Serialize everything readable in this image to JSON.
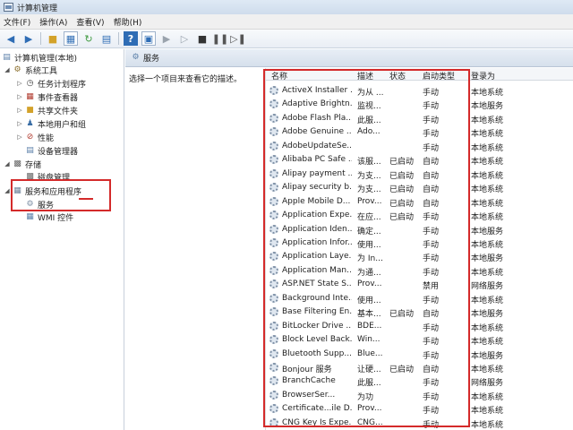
{
  "window": {
    "title": "计算机管理"
  },
  "menu": [
    "文件(F)",
    "操作(A)",
    "查看(V)",
    "帮助(H)"
  ],
  "tree": {
    "root": "计算机管理(本地)",
    "system_tools": "系统工具",
    "task_scheduler": "任务计划程序",
    "event_viewer": "事件查看器",
    "shared_folders": "共享文件夹",
    "local_users": "本地用户和组",
    "performance": "性能",
    "device_manager": "设备管理器",
    "storage": "存储",
    "disk_management": "磁盘管理",
    "services_apps": "服务和应用程序",
    "services": "服务",
    "wmi": "WMI 控件"
  },
  "content": {
    "header": "服务",
    "description": "选择一个项目来查看它的描述。"
  },
  "columns": {
    "name": "名称",
    "desc": "描述",
    "status": "状态",
    "startup": "启动类型",
    "logon": "登录为"
  },
  "services": [
    {
      "name": "ActiveX Installer ...",
      "desc": "为从 ...",
      "status": "",
      "startup": "手动",
      "logon": "本地系统"
    },
    {
      "name": "Adaptive Brightn...",
      "desc": "监视...",
      "status": "",
      "startup": "手动",
      "logon": "本地服务"
    },
    {
      "name": "Adobe Flash Pla...",
      "desc": "此服...",
      "status": "",
      "startup": "手动",
      "logon": "本地系统"
    },
    {
      "name": "Adobe Genuine ...",
      "desc": "Ado...",
      "status": "",
      "startup": "手动",
      "logon": "本地系统"
    },
    {
      "name": "AdobeUpdateSe...",
      "desc": "",
      "status": "",
      "startup": "手动",
      "logon": "本地系统"
    },
    {
      "name": "Alibaba PC Safe ...",
      "desc": "该服...",
      "status": "已启动",
      "startup": "自动",
      "logon": "本地系统"
    },
    {
      "name": "Alipay payment ...",
      "desc": "为支...",
      "status": "已启动",
      "startup": "自动",
      "logon": "本地系统"
    },
    {
      "name": "Alipay security b...",
      "desc": "为支...",
      "status": "已启动",
      "startup": "自动",
      "logon": "本地系统"
    },
    {
      "name": "Apple Mobile D...",
      "desc": "Prov...",
      "status": "已启动",
      "startup": "自动",
      "logon": "本地系统"
    },
    {
      "name": "Application Expe...",
      "desc": "在应...",
      "status": "已启动",
      "startup": "手动",
      "logon": "本地系统"
    },
    {
      "name": "Application Iden...",
      "desc": "确定...",
      "status": "",
      "startup": "手动",
      "logon": "本地服务"
    },
    {
      "name": "Application Infor...",
      "desc": "使用...",
      "status": "",
      "startup": "手动",
      "logon": "本地系统"
    },
    {
      "name": "Application Laye...",
      "desc": "为 In...",
      "status": "",
      "startup": "手动",
      "logon": "本地服务"
    },
    {
      "name": "Application Man...",
      "desc": "为通...",
      "status": "",
      "startup": "手动",
      "logon": "本地系统"
    },
    {
      "name": "ASP.NET State S...",
      "desc": "Prov...",
      "status": "",
      "startup": "禁用",
      "logon": "网络服务"
    },
    {
      "name": "Background Inte...",
      "desc": "使用...",
      "status": "",
      "startup": "手动",
      "logon": "本地系统"
    },
    {
      "name": "Base Filtering En...",
      "desc": "基本...",
      "status": "已启动",
      "startup": "自动",
      "logon": "本地服务"
    },
    {
      "name": "BitLocker Drive ...",
      "desc": "BDE...",
      "status": "",
      "startup": "手动",
      "logon": "本地系统"
    },
    {
      "name": "Block Level Back...",
      "desc": "Win...",
      "status": "",
      "startup": "手动",
      "logon": "本地系统"
    },
    {
      "name": "Bluetooth Supp...",
      "desc": "Blue...",
      "status": "",
      "startup": "手动",
      "logon": "本地服务"
    },
    {
      "name": "Bonjour 服务",
      "desc": "让硬...",
      "status": "已启动",
      "startup": "自动",
      "logon": "本地系统"
    },
    {
      "name": "BranchCache",
      "desc": "此服...",
      "status": "",
      "startup": "手动",
      "logon": "网络服务"
    },
    {
      "name": "BrowserSer...",
      "desc": "为功",
      "status": "",
      "startup": "手动",
      "logon": "本地系统"
    },
    {
      "name": "Certificate...ile D...",
      "desc": "Prov...",
      "status": "",
      "startup": "手动",
      "logon": "本地系统"
    },
    {
      "name": "CNG Key Is Expe...",
      "desc": "CNG...",
      "status": "",
      "startup": "手动",
      "logon": "本地系统"
    }
  ],
  "colors": {
    "annotation_red": "#d42a2a",
    "header_blue": "#d6e0ec"
  }
}
